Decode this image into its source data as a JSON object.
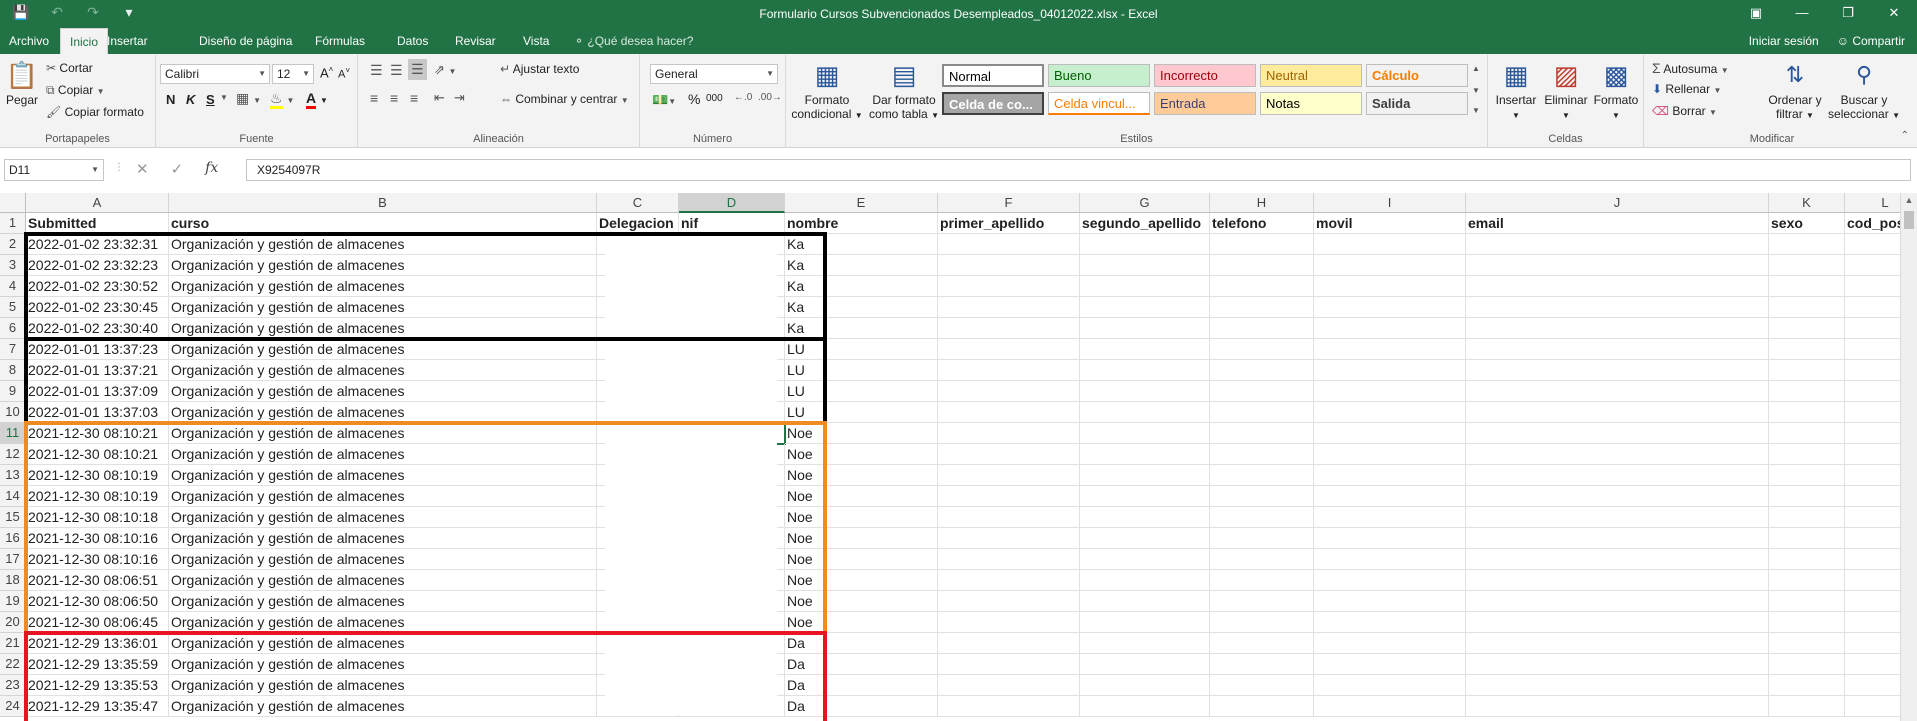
{
  "window": {
    "title": "Formulario Cursos Subvencionados Desempleados_04012022.xlsx - Excel",
    "qat": [
      "save-icon",
      "undo-icon",
      "redo-icon",
      "customize-icon"
    ]
  },
  "tabs": [
    "Archivo",
    "Inicio",
    "Insertar",
    "Diseño de página",
    "Fórmulas",
    "Datos",
    "Revisar",
    "Vista"
  ],
  "active_tab": "Inicio",
  "tell_me": "¿Qué desea hacer?",
  "account": {
    "signin": "Iniciar sesión",
    "share": "Compartir"
  },
  "ribbon": {
    "portapapeles": {
      "label": "Portapapeles",
      "pegar": "Pegar",
      "cortar": "Cortar",
      "copiar": "Copiar",
      "copiar_formato": "Copiar formato"
    },
    "fuente": {
      "label": "Fuente",
      "font": "Calibri",
      "size": "12",
      "bold": "N",
      "italic": "K",
      "underline": "S"
    },
    "alineacion": {
      "label": "Alineación",
      "ajustar": "Ajustar texto",
      "combinar": "Combinar y centrar"
    },
    "numero": {
      "label": "Número",
      "format": "General",
      "percent": "%",
      "thousands": "000"
    },
    "estilos": {
      "label": "Estilos",
      "formato_condicional": [
        "Formato",
        "condicional"
      ],
      "dar_formato": [
        "Dar formato",
        "como tabla"
      ],
      "cells": [
        {
          "name": "Normal",
          "bg": "#ffffff",
          "fg": "#000000"
        },
        {
          "name": "Bueno",
          "bg": "#c6efce",
          "fg": "#006100"
        },
        {
          "name": "Incorrecto",
          "bg": "#ffc7ce",
          "fg": "#9c0006"
        },
        {
          "name": "Neutral",
          "bg": "#ffeb9c",
          "fg": "#9c6500"
        },
        {
          "name": "Cálculo",
          "bg": "#f2f2f2",
          "fg": "#fa7d00"
        },
        {
          "name": "Celda de co...",
          "bg": "#a5a5a5",
          "fg": "#ffffff"
        },
        {
          "name": "Celda vincul...",
          "bg": "#ffffff",
          "fg": "#fa7d00"
        },
        {
          "name": "Entrada",
          "bg": "#ffcc99",
          "fg": "#3f3f76"
        },
        {
          "name": "Notas",
          "bg": "#ffffcc",
          "fg": "#000000"
        },
        {
          "name": "Salida",
          "bg": "#f2f2f2",
          "fg": "#3f3f3f"
        }
      ]
    },
    "celdas": {
      "label": "Celdas",
      "insertar": "Insertar",
      "eliminar": "Eliminar",
      "formato": "Formato"
    },
    "modificar": {
      "label": "Modificar",
      "autosuma": "Autosuma",
      "rellenar": "Rellenar",
      "borrar": "Borrar",
      "ordenar": [
        "Ordenar y",
        "filtrar"
      ],
      "buscar": [
        "Buscar y",
        "seleccionar"
      ]
    }
  },
  "formula_bar": {
    "cell_ref": "D11",
    "value": "X9254097R",
    "fx": "fx"
  },
  "sheet": {
    "columns": [
      "A",
      "B",
      "C",
      "D",
      "E",
      "F",
      "G",
      "H",
      "I",
      "J",
      "K",
      "L"
    ],
    "selected_column": "D",
    "selected_row": 11,
    "headers": [
      "Submitted",
      "curso",
      "Delegacion",
      "nif",
      "nombre",
      "primer_apellido",
      "segundo_apellido",
      "telefono",
      "movil",
      "email",
      "sexo",
      "cod_pos"
    ],
    "rows": [
      {
        "n": 2,
        "submitted": "2022-01-02 23:32:31",
        "curso": "Organización y gestión de almacenes",
        "nombre": "Ka"
      },
      {
        "n": 3,
        "submitted": "2022-01-02 23:32:23",
        "curso": "Organización y gestión de almacenes",
        "nombre": "Ka"
      },
      {
        "n": 4,
        "submitted": "2022-01-02 23:30:52",
        "curso": "Organización y gestión de almacenes",
        "nombre": "Ka"
      },
      {
        "n": 5,
        "submitted": "2022-01-02 23:30:45",
        "curso": "Organización y gestión de almacenes",
        "nombre": "Ka"
      },
      {
        "n": 6,
        "submitted": "2022-01-02 23:30:40",
        "curso": "Organización y gestión de almacenes",
        "nombre": "Ka"
      },
      {
        "n": 7,
        "submitted": "2022-01-01 13:37:23",
        "curso": "Organización y gestión de almacenes",
        "nombre": "LU"
      },
      {
        "n": 8,
        "submitted": "2022-01-01 13:37:21",
        "curso": "Organización y gestión de almacenes",
        "nombre": "LU"
      },
      {
        "n": 9,
        "submitted": "2022-01-01 13:37:09",
        "curso": "Organización y gestión de almacenes",
        "nombre": "LU"
      },
      {
        "n": 10,
        "submitted": "2022-01-01 13:37:03",
        "curso": "Organización y gestión de almacenes",
        "nombre": "LU"
      },
      {
        "n": 11,
        "submitted": "2021-12-30 08:10:21",
        "curso": "Organización y gestión de almacenes",
        "nombre": "Noe"
      },
      {
        "n": 12,
        "submitted": "2021-12-30 08:10:21",
        "curso": "Organización y gestión de almacenes",
        "nombre": "Noe"
      },
      {
        "n": 13,
        "submitted": "2021-12-30 08:10:19",
        "curso": "Organización y gestión de almacenes",
        "nombre": "Noe"
      },
      {
        "n": 14,
        "submitted": "2021-12-30 08:10:19",
        "curso": "Organización y gestión de almacenes",
        "nombre": "Noe"
      },
      {
        "n": 15,
        "submitted": "2021-12-30 08:10:18",
        "curso": "Organización y gestión de almacenes",
        "nombre": "Noe"
      },
      {
        "n": 16,
        "submitted": "2021-12-30 08:10:16",
        "curso": "Organización y gestión de almacenes",
        "nombre": "Noe"
      },
      {
        "n": 17,
        "submitted": "2021-12-30 08:10:16",
        "curso": "Organización y gestión de almacenes",
        "nombre": "Noe"
      },
      {
        "n": 18,
        "submitted": "2021-12-30 08:06:51",
        "curso": "Organización y gestión de almacenes",
        "nombre": "Noe"
      },
      {
        "n": 19,
        "submitted": "2021-12-30 08:06:50",
        "curso": "Organización y gestión de almacenes",
        "nombre": "Noe"
      },
      {
        "n": 20,
        "submitted": "2021-12-30 08:06:45",
        "curso": "Organización y gestión de almacenes",
        "nombre": "Noe"
      },
      {
        "n": 21,
        "submitted": "2021-12-29 13:36:01",
        "curso": "Organización y gestión de almacenes",
        "nombre": "Da"
      },
      {
        "n": 22,
        "submitted": "2021-12-29 13:35:59",
        "curso": "Organización y gestión de almacenes",
        "nombre": "Da"
      },
      {
        "n": 23,
        "submitted": "2021-12-29 13:35:53",
        "curso": "Organización y gestión de almacenes",
        "nombre": "Da"
      },
      {
        "n": 24,
        "submitted": "2021-12-29 13:35:47",
        "curso": "Organización y gestión de almacenes",
        "nombre": "Da"
      }
    ],
    "highlight_colors": {
      "group_1": "#000000",
      "group_2": "#000000",
      "group_3": "#f08a24",
      "group_4": "#e8141f"
    }
  }
}
